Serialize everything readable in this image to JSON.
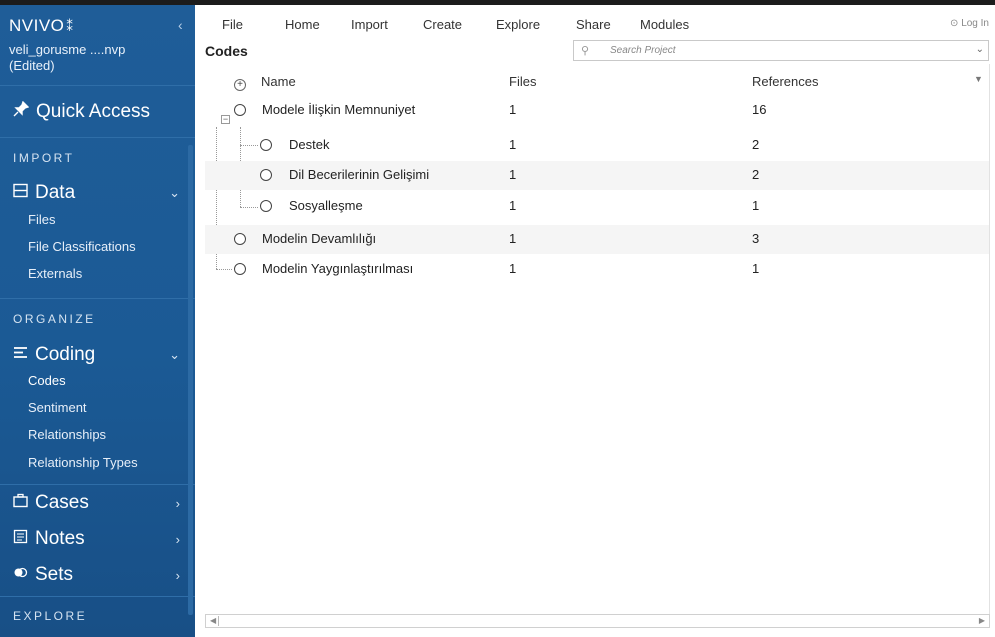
{
  "sidebar": {
    "logo": "NVIVO",
    "logo_dots": "⁑",
    "collapse_glyph": "‹",
    "project_file": "veli_gorusme ....nvp",
    "project_status": "(Edited)",
    "quick_access": "Quick Access",
    "sections": {
      "import": "IMPORT",
      "organize": "ORGANIZE",
      "explore": "EXPLORE"
    },
    "data": {
      "label": "Data",
      "items": [
        "Files",
        "File Classifications",
        "Externals"
      ]
    },
    "coding": {
      "label": "Coding",
      "items": [
        "Codes",
        "Sentiment",
        "Relationships",
        "Relationship Types"
      ]
    },
    "cases": "Cases",
    "notes": "Notes",
    "sets": "Sets"
  },
  "menu": {
    "items": [
      "File",
      "Home",
      "Import",
      "Create",
      "Explore",
      "Share",
      "Modules"
    ],
    "login": "Log In"
  },
  "codes": {
    "title": "Codes",
    "search_placeholder": "Search Project",
    "columns": {
      "name": "Name",
      "files": "Files",
      "references": "References"
    },
    "rows": [
      {
        "name": "Modele İlişkin Memnuniyet",
        "files": "1",
        "references": "16"
      },
      {
        "name": "Destek",
        "files": "1",
        "references": "2"
      },
      {
        "name": "Dil Becerilerinin Gelişimi",
        "files": "1",
        "references": "2"
      },
      {
        "name": "Sosyalleşme",
        "files": "1",
        "references": "1"
      },
      {
        "name": "Modelin Devamlılığı",
        "files": "1",
        "references": "3"
      },
      {
        "name": "Modelin Yaygınlaştırılması",
        "files": "1",
        "references": "1"
      }
    ]
  },
  "colors": {
    "sidebar": "#1f5d98",
    "accent": "#ffffff"
  }
}
